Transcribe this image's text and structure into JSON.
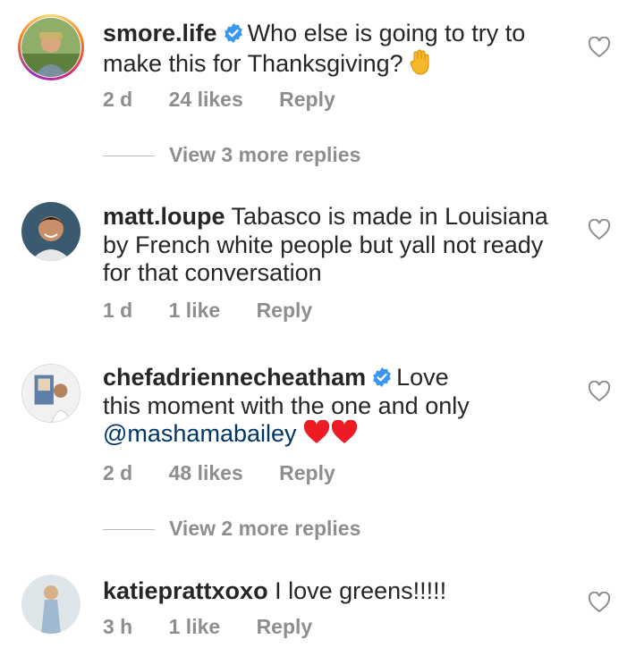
{
  "comments": [
    {
      "username": "smore.life",
      "verified": true,
      "text": "Who else is going to try to make this for Thanksgiving?",
      "emoji": "raised-hand",
      "time": "2 d",
      "likes": "24 likes",
      "reply": "Reply",
      "view_more": "View 3 more replies"
    },
    {
      "username": "matt.loupe",
      "verified": false,
      "text": "Tabasco is made in Louisiana by French white people but yall not ready for that conversation",
      "time": "1 d",
      "likes": "1 like",
      "reply": "Reply"
    },
    {
      "username": "chefadriennecheatham",
      "verified": true,
      "text_line1": "Love",
      "text_line2": "this moment with the one and only",
      "mention": "@mashamabailey",
      "emoji": "two-red-hearts",
      "time": "2 d",
      "likes": "48 likes",
      "reply": "Reply",
      "view_more": "View 2 more replies"
    },
    {
      "username": "katieprattxoxo",
      "verified": false,
      "text": "I love greens!!!!!",
      "time": "3 h",
      "likes": "1 like",
      "reply": "Reply"
    }
  ],
  "colors": {
    "verified_blue": "#3897f0",
    "muted": "#8e8e8e",
    "mention": "#003569",
    "heart_red": "#ed1c24"
  }
}
